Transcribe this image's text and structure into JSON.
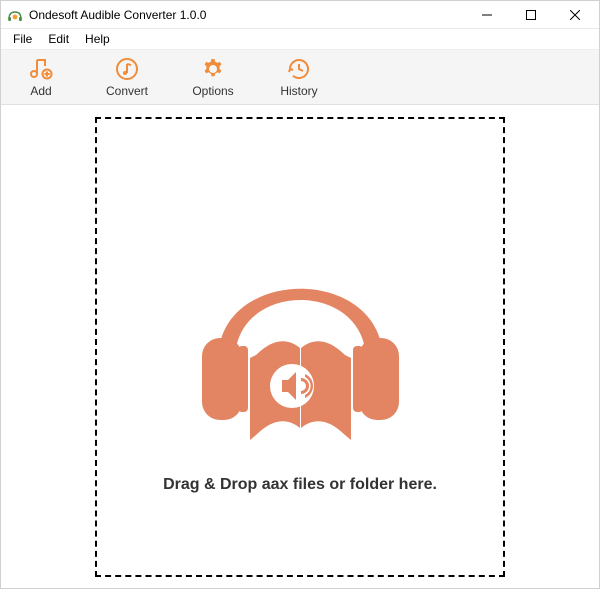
{
  "titlebar": {
    "title": "Ondesoft Audible Converter 1.0.0"
  },
  "menubar": {
    "file": "File",
    "edit": "Edit",
    "help": "Help"
  },
  "toolbar": {
    "add": "Add",
    "convert": "Convert",
    "options": "Options",
    "history": "History"
  },
  "dropzone": {
    "text": "Drag & Drop aax files or folder here."
  },
  "colors": {
    "accent": "#f08c3a",
    "logo": "#e38562"
  }
}
